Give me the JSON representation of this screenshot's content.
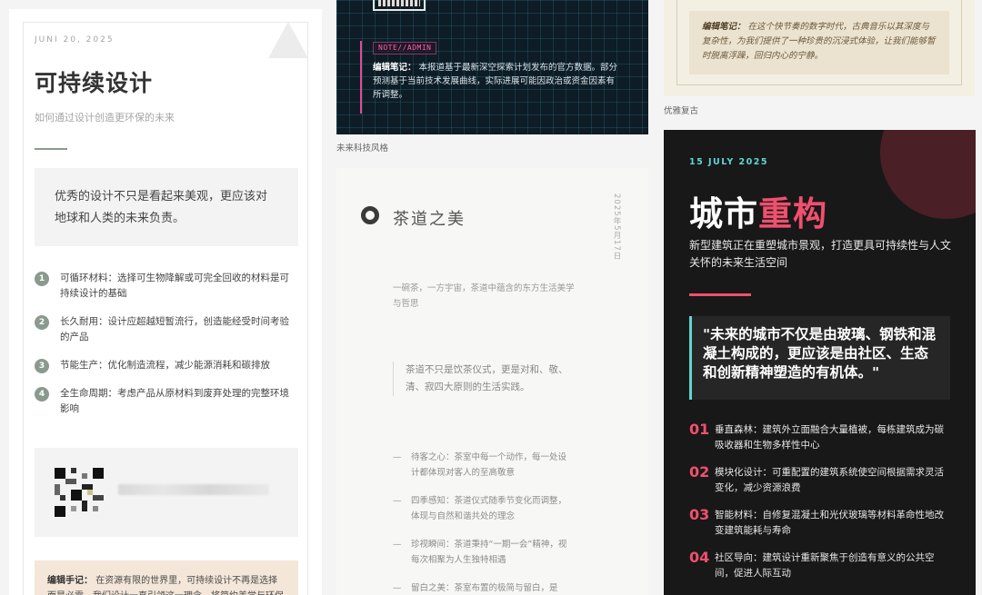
{
  "card1": {
    "date": "JUNI 20, 2025",
    "title": "可持续设计",
    "subtitle": "如何通过设计创造更环保的未来",
    "quote": "优秀的设计不只是看起来美观，更应该对地球和人类的未来负责。",
    "items": [
      {
        "num": "1",
        "text": "可循环材料：选择可生物降解或可完全回收的材料是可持续设计的基础"
      },
      {
        "num": "2",
        "text": "长久耐用：设计应超越短暂流行，创造能经受时间考验的产品"
      },
      {
        "num": "3",
        "text": "节能生产：优化制造流程，减少能源消耗和碳排放"
      },
      {
        "num": "4",
        "text": "全生命周期：考虑产品从原材料到废弃处理的完整环境影响"
      }
    ],
    "note_label": "编辑手记：",
    "note_text": "在资源有限的世界里，可持续设计不再是选择而是必需。我们设计一直引领这一理念，将简约美学与环保责"
  },
  "card2": {
    "tag": "NOTE//ADMIN",
    "note_label": "编辑笔记：",
    "note_text": "本报道基于最新深空探索计划发布的官方数据。部分预测基于当前技术发展曲线，实际进展可能因政治或资金因素有所调整。",
    "caption": "未来科技风格"
  },
  "card3": {
    "title": "茶道之美",
    "vertical_date": "2025年5月17日",
    "intro": "一碗茶，一方宇宙，茶道中蕴含的东方生活美学与哲思",
    "quote": "茶道不只是饮茶仪式，更是对和、敬、清、寂四大原则的生活实践。",
    "dash": "—",
    "items": [
      "待客之心：茶室中每一个动作，每一处设计都体现对客人的至高敬意",
      "四季感知：茶道仪式随季节变化而调整，体现与自然和谐共处的理念",
      "珍视瞬间：茶道秉持“一期一会”精神，视每次相聚为人生独特相遇",
      "留白之美：茶室布置的极简与留白，是"
    ]
  },
  "card4": {
    "note_label": "编辑笔记：",
    "note_text": "在这个快节奏的数字时代，古典音乐以其深度与复杂性，为我们提供了一种珍贵的沉浸式体验，让我们能够暂时脱离浮躁，回归内心的宁静。",
    "caption": "优雅复古"
  },
  "card5": {
    "date": "15 JULY 2025",
    "title_main": "城市",
    "title_highlight": "重构",
    "subtitle": "新型建筑正在重塑城市景观，打造更具可持续性与人文关怀的未来生活空间",
    "quote": "\"未来的城市不仅是由玻璃、钢铁和混凝土构成的，更应该是由社区、生态和创新精神塑造的有机体。\"",
    "items": [
      {
        "num": "01",
        "text": "垂直森林：建筑外立面融合大量植被，每栋建筑成为碳吸收器和生物多样性中心"
      },
      {
        "num": "02",
        "text": "模块化设计：可重配置的建筑系统使空间根据需求灵活变化，减少资源浪费"
      },
      {
        "num": "03",
        "text": "智能材料：自修复混凝土和光伏玻璃等材料革命性地改变建筑能耗与寿命"
      },
      {
        "num": "04",
        "text": "社区导向：建筑设计重新聚焦于创造有意义的公共空间，促进人际互动"
      }
    ]
  }
}
